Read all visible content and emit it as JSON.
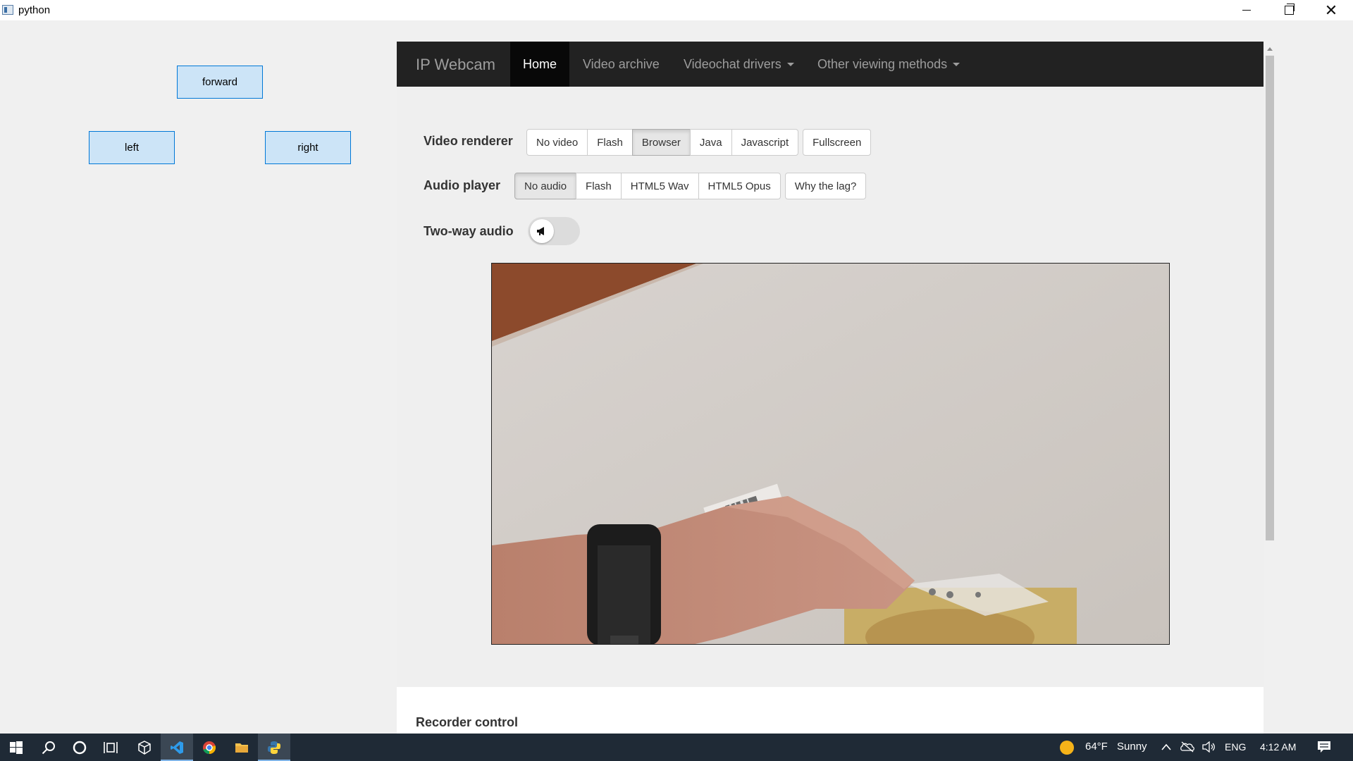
{
  "window": {
    "title": "python"
  },
  "controls": {
    "forward": "forward",
    "left": "left",
    "right": "right"
  },
  "browser": {
    "brand": "IP Webcam",
    "nav": [
      {
        "label": "Home",
        "active": true
      },
      {
        "label": "Video archive"
      },
      {
        "label": "Videochat drivers",
        "dropdown": true
      },
      {
        "label": "Other viewing methods",
        "dropdown": true
      }
    ],
    "video_renderer": {
      "label": "Video renderer",
      "options": [
        "No video",
        "Flash",
        "Browser",
        "Java",
        "Javascript"
      ],
      "selected": "Browser",
      "fullscreen": "Fullscreen"
    },
    "audio_player": {
      "label": "Audio player",
      "options": [
        "No audio",
        "Flash",
        "HTML5 Wav",
        "HTML5 Opus"
      ],
      "selected": "No audio",
      "help": "Why the lag?"
    },
    "two_way_audio": {
      "label": "Two-way audio",
      "enabled": false
    },
    "recorder": {
      "title": "Recorder control"
    }
  },
  "taskbar": {
    "weather": {
      "temp": "64°F",
      "condition": "Sunny"
    },
    "language": "ENG",
    "time": "4:12 AM"
  },
  "colors": {
    "navbar": "#222222",
    "button_face": "#cce4f7",
    "button_border": "#0078d7",
    "taskbar": "#1f2a36"
  }
}
